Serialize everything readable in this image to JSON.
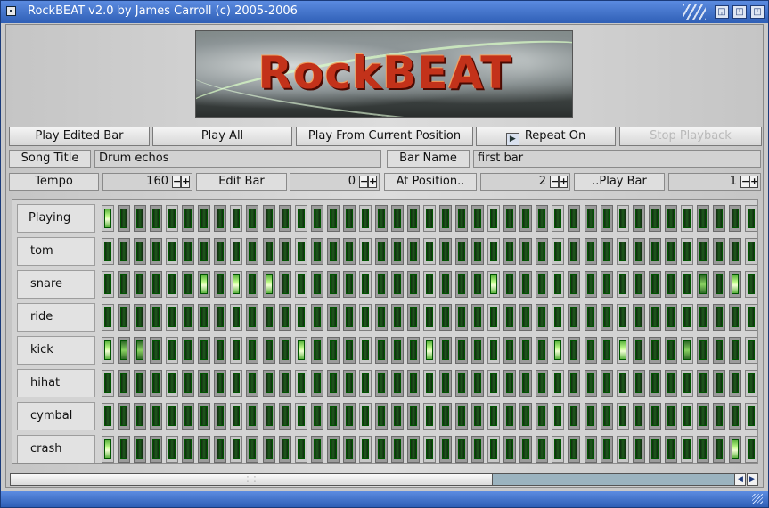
{
  "window": {
    "title": "RockBEAT v2.0 by James Carroll (c) 2005-2006"
  },
  "banner": {
    "logo_text": "RockBEAT"
  },
  "toolbar": {
    "play_edited_bar": "Play Edited Bar",
    "play_all": "Play All",
    "play_from_current": "Play From Current Position",
    "repeat_on": "Repeat On",
    "stop_playback": "Stop Playback"
  },
  "song": {
    "title_label": "Song Title",
    "title_value": "Drum echos",
    "bar_name_label": "Bar Name",
    "bar_name_value": "first bar"
  },
  "controls": {
    "tempo_label": "Tempo",
    "tempo_value": "160",
    "edit_bar_label": "Edit Bar",
    "edit_bar_value": "0",
    "at_position_label": "At Position..",
    "at_position_value": "2",
    "play_bar_label": "..Play Bar",
    "play_bar_value": "1"
  },
  "rows": [
    {
      "name": "Playing",
      "on": [
        0
      ],
      "dim": []
    },
    {
      "name": "tom",
      "on": [],
      "dim": []
    },
    {
      "name": "snare",
      "on": [
        6,
        8,
        10,
        24,
        39
      ],
      "dim": [
        37
      ]
    },
    {
      "name": "ride",
      "on": [],
      "dim": []
    },
    {
      "name": "kick",
      "on": [
        0,
        12,
        20,
        28,
        32
      ],
      "dim": [
        1,
        2,
        36
      ]
    },
    {
      "name": "hihat",
      "on": [],
      "dim": []
    },
    {
      "name": "cymbal",
      "on": [],
      "dim": []
    },
    {
      "name": "crash",
      "on": [
        0,
        39
      ],
      "dim": []
    }
  ]
}
